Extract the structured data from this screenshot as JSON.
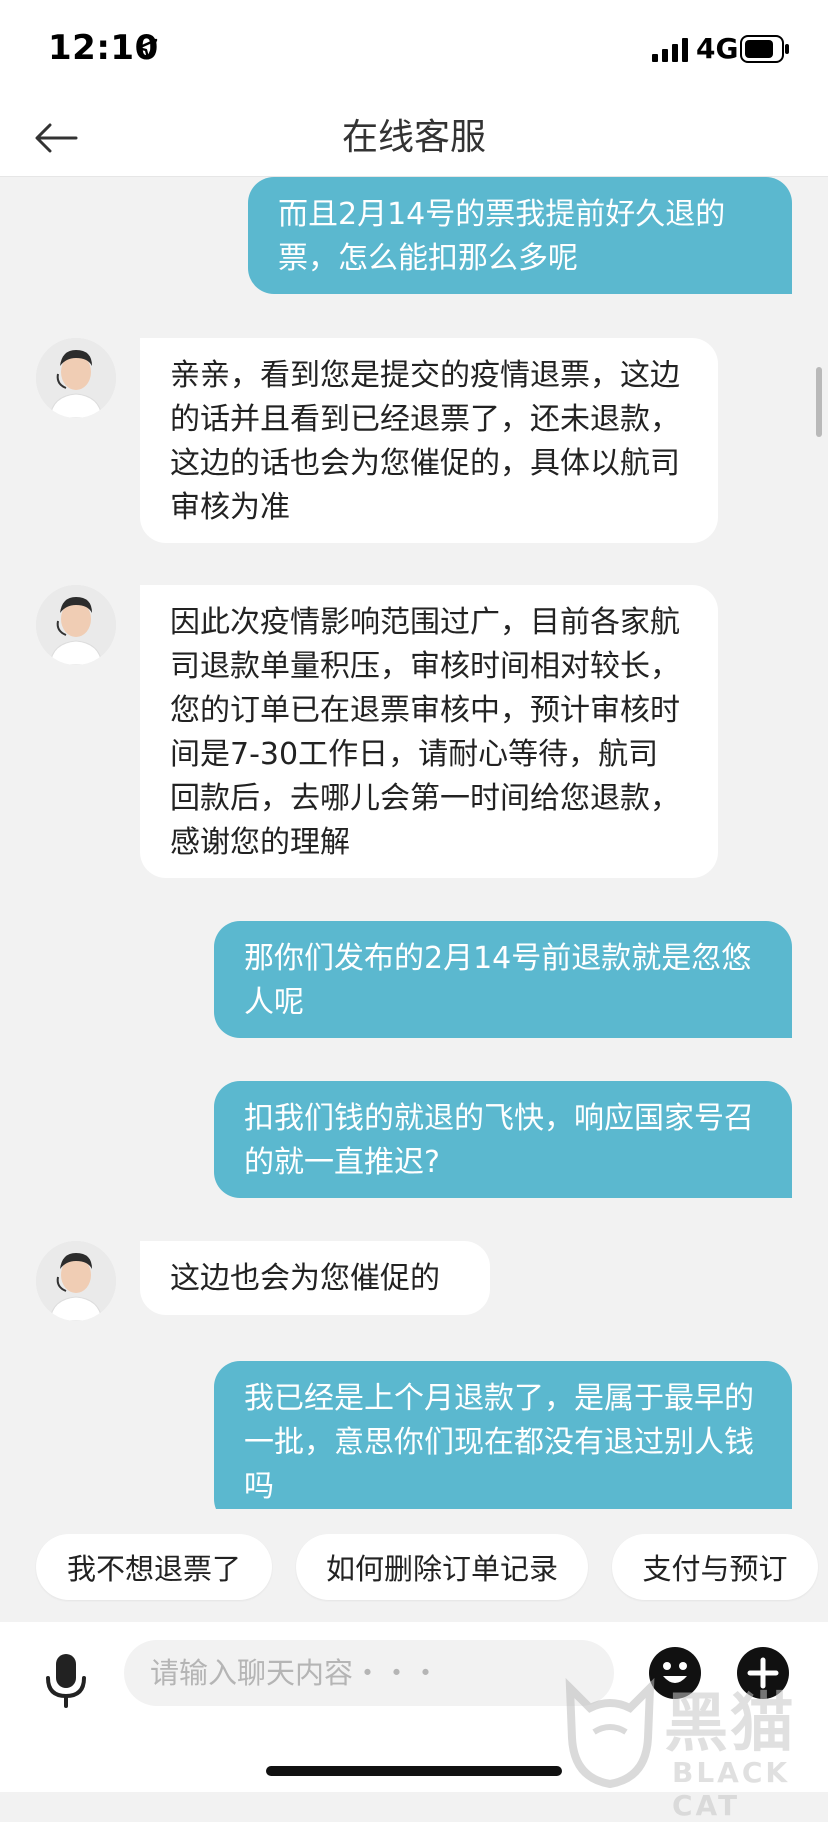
{
  "status_bar": {
    "time": "12:10",
    "network": "4G"
  },
  "nav": {
    "title": "在线客服"
  },
  "messages": [
    {
      "from": "user",
      "text": "而且2月14号的票我提前好久退的票，怎么能扣那么多呢"
    },
    {
      "from": "agent",
      "text": "亲亲，看到您是提交的疫情退票，这边的话并且看到已经退票了，还未退款，这边的话也会为您催促的，具体以航司审核为准"
    },
    {
      "from": "agent",
      "text": "因此次疫情影响范围过广，目前各家航司退款单量积压，审核时间相对较长，您的订单已在退票审核中，预计审核时间是7-30工作日，请耐心等待，航司回款后，去哪儿会第一时间给您退款，感谢您的理解"
    },
    {
      "from": "user",
      "text": "那你们发布的2月14号前退款就是忽悠人呢"
    },
    {
      "from": "user",
      "text": "扣我们钱的就退的飞快，响应国家号召的就一直推迟?"
    },
    {
      "from": "agent",
      "text": "这边也会为您催促的"
    },
    {
      "from": "user",
      "text": "我已经是上个月退款了，是属于最早的一批，意思你们现在都没有退过别人钱吗"
    }
  ],
  "quick_replies": [
    "我不想退票了",
    "如何删除订单记录",
    "支付与预订"
  ],
  "input": {
    "placeholder": "请输入聊天内容・・・"
  },
  "watermark": {
    "cn": "黑猫",
    "en": "BLACK CAT"
  },
  "colors": {
    "user_bubble": "#5bb8cf",
    "agent_bubble": "#ffffff",
    "background": "#f2f2f2"
  }
}
